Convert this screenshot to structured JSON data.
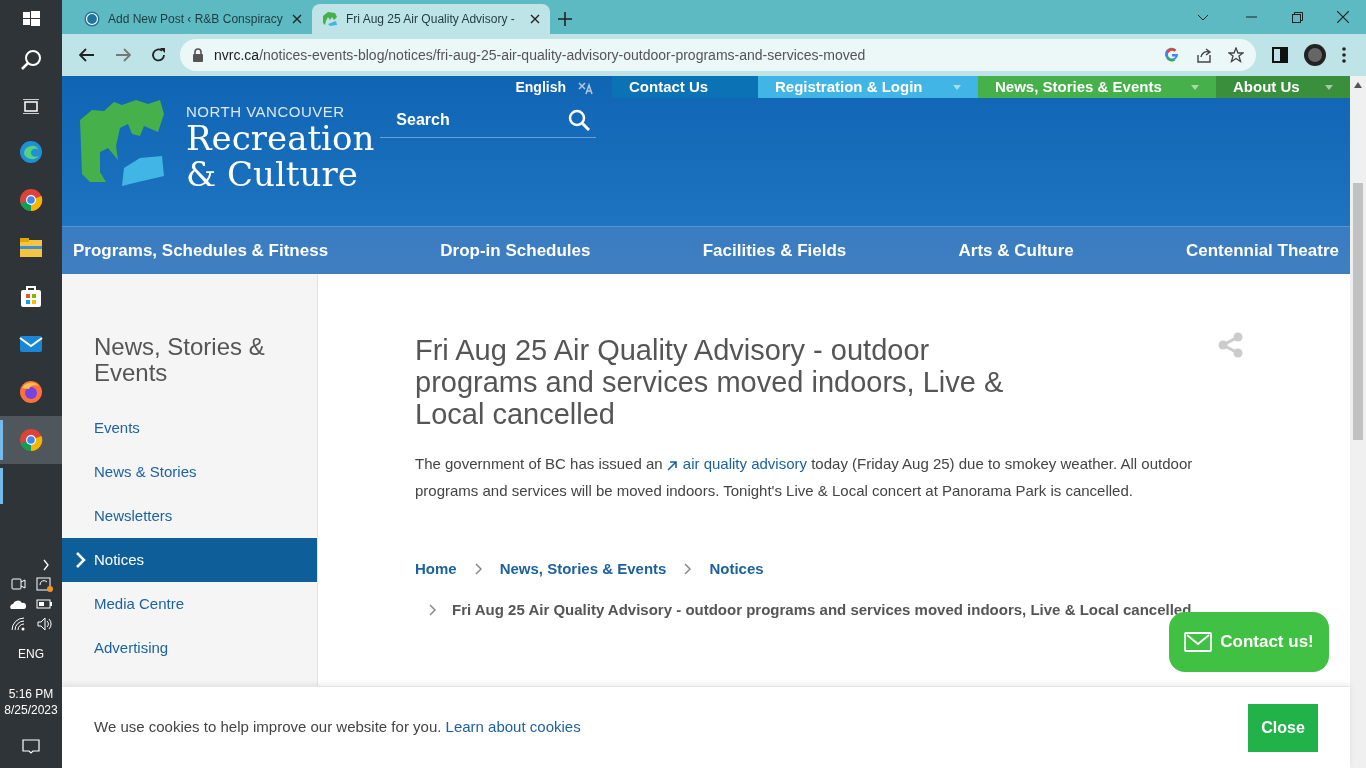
{
  "taskbar": {
    "apps": [
      {
        "kind": "edge",
        "selected": false
      },
      {
        "kind": "chrome",
        "selected": false
      },
      {
        "kind": "files",
        "selected": false
      },
      {
        "kind": "store",
        "selected": false
      },
      {
        "kind": "mail",
        "selected": false
      },
      {
        "kind": "firefox",
        "selected": false
      },
      {
        "kind": "chrome",
        "selected": true
      }
    ],
    "language": "ENG",
    "time": "5:16 PM",
    "date": "8/25/2023"
  },
  "browser": {
    "tabs": [
      {
        "title": "Add New Post ‹ R&B Conspiracy",
        "kind": "wordpress",
        "selected": false
      },
      {
        "title": "Fri Aug 25 Air Quality Advisory -",
        "kind": "site",
        "selected": true
      }
    ],
    "url_host": "nvrc.ca",
    "url_path": "/notices-events-blog/notices/fri-aug-25-air-quality-advisory-outdoor-programs-and-services-moved"
  },
  "site": {
    "language": "English",
    "utility_nav": [
      {
        "label": "Contact Us",
        "color": "#0b72b5",
        "dropdown": false
      },
      {
        "label": "Registration & Login",
        "color": "#41b6e6",
        "dropdown": true
      },
      {
        "label": "News, Stories & Events",
        "color": "#46b04a",
        "dropdown": true
      },
      {
        "label": "About Us",
        "color": "#3a8f3d",
        "dropdown": true
      }
    ],
    "logo": {
      "tagline": "NORTH VANCOUVER",
      "line_1": "Recreation",
      "line_2": "& Culture"
    },
    "search": {
      "placeholder": "Search"
    },
    "main_nav": [
      "Programs, Schedules & Fitness",
      "Drop-in Schedules",
      "Facilities & Fields",
      "Arts & Culture",
      "Centennial Theatre"
    ],
    "sidebar": {
      "title": "News, Stories & Events",
      "items": [
        {
          "label": "Events",
          "selected": false
        },
        {
          "label": "News & Stories",
          "selected": false
        },
        {
          "label": "Newsletters",
          "selected": false
        },
        {
          "label": "Notices",
          "selected": true
        },
        {
          "label": "Media Centre",
          "selected": false
        },
        {
          "label": "Advertising",
          "selected": false
        }
      ]
    },
    "article": {
      "title": "Fri Aug 25 Air Quality Advisory - outdoor programs and services moved indoors, Live & Local cancelled",
      "body_before": "The government of BC has issued an",
      "body_link": "air quality advisory",
      "body_after": "today (Friday Aug 25) due to smokey weather. All outdoor programs and services will be moved indoors. Tonight's Live & Local concert at Panorama Park is cancelled.",
      "breadcrumbs": [
        "Home",
        "News, Stories & Events",
        "Notices"
      ],
      "current_page": "Fri Aug 25 Air Quality Advisory - outdoor programs and services moved indoors, Live & Local cancelled"
    },
    "contact_button": "Contact us!",
    "cookie_bar": {
      "text": "We use cookies to help improve our website for you.",
      "link": "Learn about cookies",
      "close": "Close"
    }
  }
}
